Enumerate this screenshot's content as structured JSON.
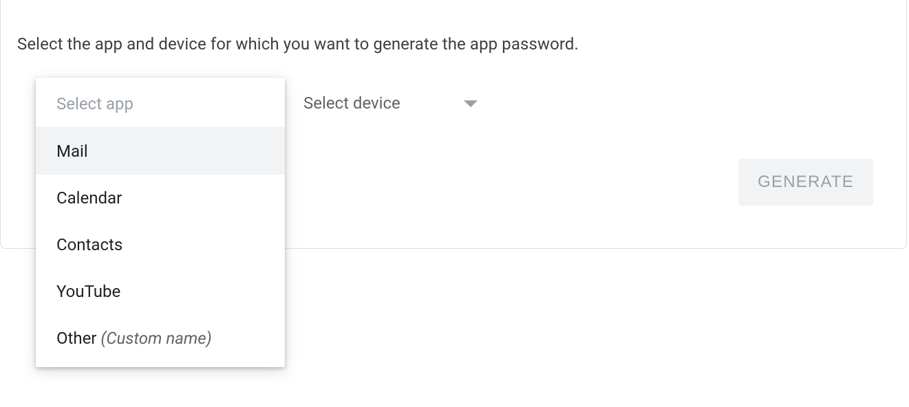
{
  "instruction": "Select the app and device for which you want to generate the app password.",
  "app_select": {
    "label": "Select app",
    "options": [
      {
        "label": "Mail",
        "highlighted": true
      },
      {
        "label": "Calendar",
        "highlighted": false
      },
      {
        "label": "Contacts",
        "highlighted": false
      },
      {
        "label": "YouTube",
        "highlighted": false
      },
      {
        "label": "Other",
        "hint": "(Custom name)",
        "highlighted": false
      }
    ]
  },
  "device_select": {
    "label": "Select device"
  },
  "generate_button": "GENERATE"
}
